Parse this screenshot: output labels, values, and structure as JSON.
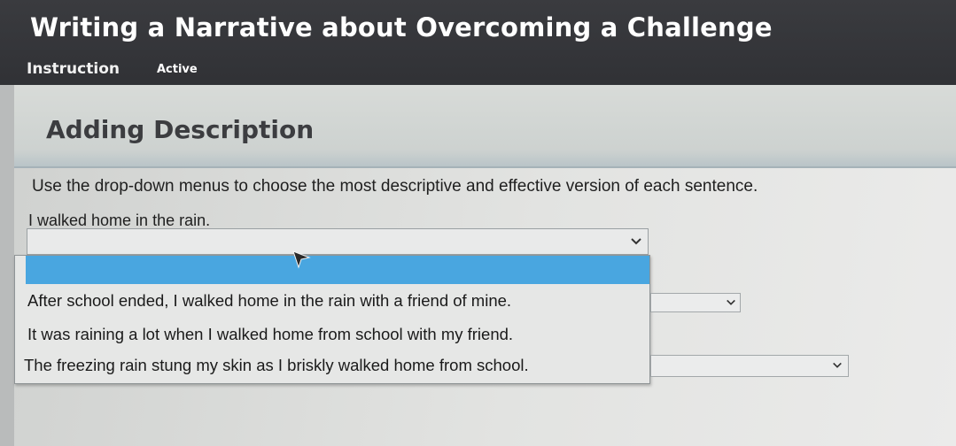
{
  "header": {
    "title": "Writing a Narrative about Overcoming a Challenge",
    "tabs": [
      {
        "label": "Instruction"
      },
      {
        "label": "Active"
      }
    ]
  },
  "section": {
    "title": "Adding Description",
    "instructions": "Use the drop-down menus to choose the most descriptive and effective version of each sentence.",
    "prompt": "I walked home in the rain."
  },
  "dropdown": {
    "selected": "",
    "options": [
      "",
      "After school ended, I walked home in the rain with a friend of mine.",
      "It was raining a lot when I walked home from school with my friend.",
      "The freezing rain stung my skin as I briskly walked home from school."
    ]
  },
  "other_dropdowns": [
    {
      "selected": ""
    },
    {
      "selected": ""
    }
  ],
  "colors": {
    "header_bg": "#333438",
    "highlight": "#49a6e0"
  },
  "icons": [
    "chevron-down-icon",
    "mouse-cursor-icon"
  ]
}
